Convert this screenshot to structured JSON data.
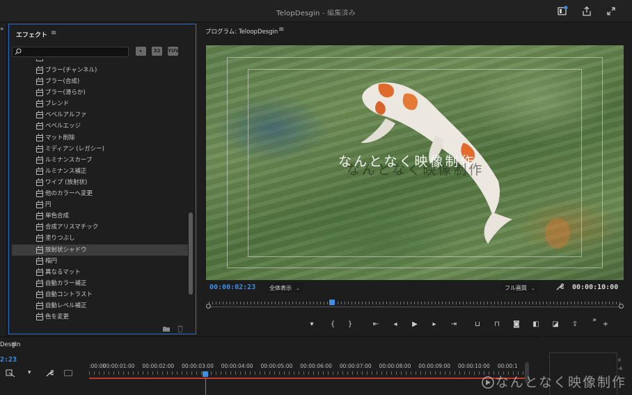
{
  "window": {
    "title": "TelopDesgin",
    "title_status": " - 編集済み"
  },
  "effects_panel": {
    "title": "エフェクト",
    "filter_labels": [
      "32",
      "YUV"
    ],
    "items": [
      {
        "label": "ブラー(チャンネル)",
        "selected": false
      },
      {
        "label": "ブラー(合成)",
        "selected": false
      },
      {
        "label": "ブラー(滑らか)",
        "selected": false
      },
      {
        "label": "ブレンド",
        "selected": false
      },
      {
        "label": "ベベルアルファ",
        "selected": false
      },
      {
        "label": "ベベルエッジ",
        "selected": false
      },
      {
        "label": "マット削除",
        "selected": false
      },
      {
        "label": "ミディアン (レガシー)",
        "selected": false
      },
      {
        "label": "ルミナンスカーブ",
        "selected": false
      },
      {
        "label": "ルミナンス補正",
        "selected": false
      },
      {
        "label": "ワイプ (放射状)",
        "selected": false
      },
      {
        "label": "他のカラーへ変更",
        "selected": false
      },
      {
        "label": "円",
        "selected": false
      },
      {
        "label": "単色合成",
        "selected": false
      },
      {
        "label": "合成アリスマチック",
        "selected": false
      },
      {
        "label": "塗りつぶし",
        "selected": false
      },
      {
        "label": "放射状シャドウ",
        "selected": true
      },
      {
        "label": "楕円",
        "selected": false
      },
      {
        "label": "異なるマット",
        "selected": false
      },
      {
        "label": "自動カラー補正",
        "selected": false
      },
      {
        "label": "自動コントラスト",
        "selected": false
      },
      {
        "label": "自動レベル補正",
        "selected": false
      },
      {
        "label": "色を変更",
        "selected": false
      }
    ]
  },
  "program_monitor": {
    "title": "プログラム: TeloopDesgin",
    "overlay_text": "なんとなく映像制作",
    "current_timecode": "00:00:02:23",
    "fit_option": "全体表示",
    "quality_option": "フル画質",
    "duration_timecode": "00:00:10:00",
    "playhead_fraction": 0.2996
  },
  "timeline": {
    "title": "Desgin",
    "current_timecode": "2:23",
    "ruler_labels": [
      ":00:00",
      "00:00:01:00",
      "00:00:02:00",
      "00:00:03:00",
      "00:00:04:00",
      "00:00:05:00",
      "00:00:06:00",
      "00:00:07:00",
      "00:00:08:00",
      "00:00:09:00",
      "00:00:10:00",
      "00:00:1"
    ]
  },
  "audio_meter": {
    "scale": [
      "0",
      "-6"
    ]
  },
  "watermark": {
    "text": "なんとなく映像制作"
  },
  "colors": {
    "accent_blue": "#3d8fe6",
    "panel_focus_border": "#2f6fcf",
    "work_area_red": "#c0392b"
  }
}
